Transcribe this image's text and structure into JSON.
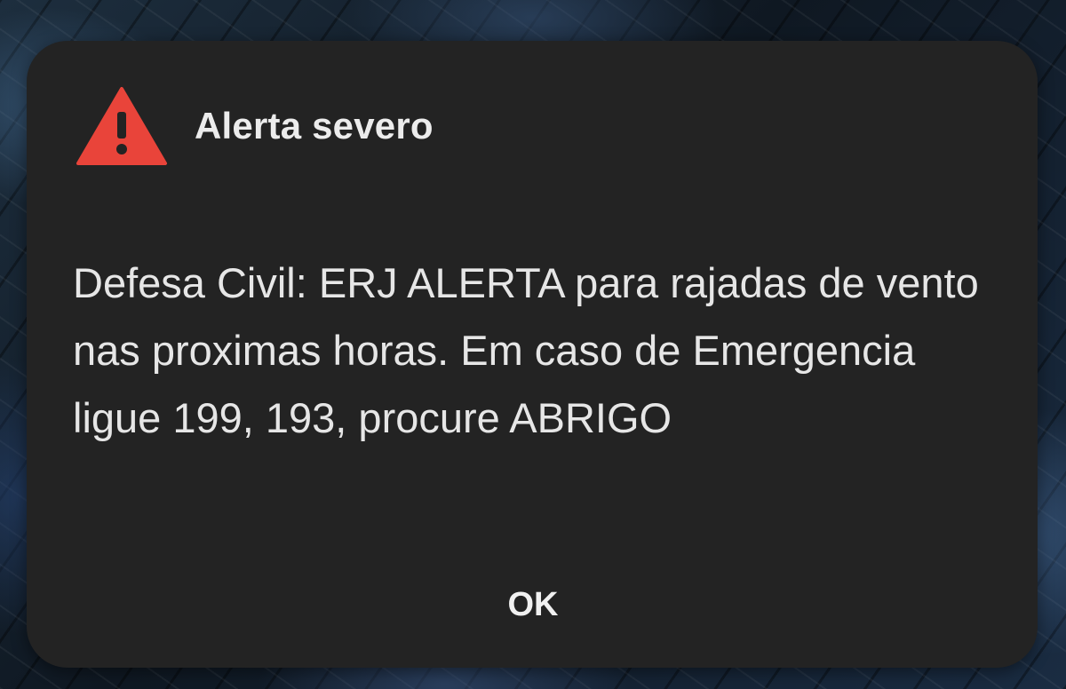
{
  "alert": {
    "icon": "warning-triangle-icon",
    "icon_color": "#e9443a",
    "title": "Alerta severo",
    "message": "Defesa Civil: ERJ ALERTA para rajadas de vento nas proximas horas. Em caso de Emergencia ligue 199, 193, procure ABRIGO",
    "ok_label": "OK"
  }
}
